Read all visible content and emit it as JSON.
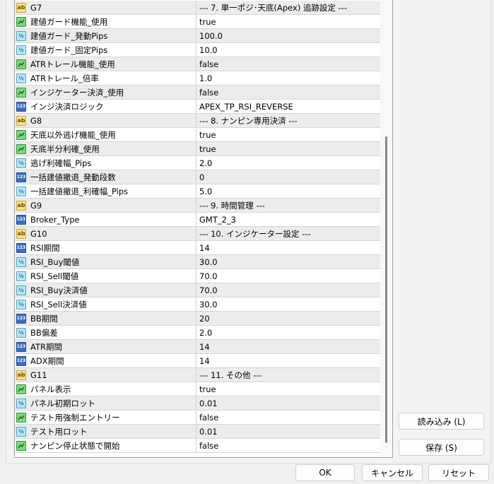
{
  "rows": [
    {
      "type": "string",
      "icon": "ab",
      "name": "G7",
      "value": "--- 7. 単一ポジ･天底(Apex) 追跡設定 ---"
    },
    {
      "type": "bool",
      "icon": "bool",
      "name": "建値ガード機能_使用",
      "value": "true"
    },
    {
      "type": "double",
      "icon": "½",
      "name": "建値ガード_発動Pips",
      "value": "100.0"
    },
    {
      "type": "double",
      "icon": "½",
      "name": "建値ガード_固定Pips",
      "value": "10.0"
    },
    {
      "type": "bool",
      "icon": "bool",
      "name": "ATRトレール機能_使用",
      "value": "false"
    },
    {
      "type": "double",
      "icon": "½",
      "name": "ATRトレール_倍率",
      "value": "1.0"
    },
    {
      "type": "bool",
      "icon": "bool",
      "name": "インジケーター決済_使用",
      "value": "false"
    },
    {
      "type": "int",
      "icon": "123",
      "name": "インジ決済ロジック",
      "value": "APEX_TP_RSI_REVERSE"
    },
    {
      "type": "string",
      "icon": "ab",
      "name": "G8",
      "value": "--- 8. ナンピン専用決済 ---"
    },
    {
      "type": "bool",
      "icon": "bool",
      "name": "天底以外逃げ機能_使用",
      "value": "true"
    },
    {
      "type": "bool",
      "icon": "bool",
      "name": "天底半分利確_使用",
      "value": "true"
    },
    {
      "type": "double",
      "icon": "½",
      "name": "逃げ利確幅_Pips",
      "value": "2.0"
    },
    {
      "type": "int",
      "icon": "123",
      "name": "一括建値撤退_発動段数",
      "value": "0"
    },
    {
      "type": "double",
      "icon": "½",
      "name": "一括建値撤退_利確幅_Pips",
      "value": "5.0"
    },
    {
      "type": "string",
      "icon": "ab",
      "name": "G9",
      "value": "--- 9. 時間管理 ---"
    },
    {
      "type": "int",
      "icon": "123",
      "name": "Broker_Type",
      "value": "GMT_2_3"
    },
    {
      "type": "string",
      "icon": "ab",
      "name": "G10",
      "value": "--- 10. インジケーター設定 ---"
    },
    {
      "type": "int",
      "icon": "123",
      "name": "RSI期間",
      "value": "14"
    },
    {
      "type": "double",
      "icon": "½",
      "name": "RSI_Buy閾値",
      "value": "30.0"
    },
    {
      "type": "double",
      "icon": "½",
      "name": "RSI_Sell閾値",
      "value": "70.0"
    },
    {
      "type": "double",
      "icon": "½",
      "name": "RSI_Buy決済値",
      "value": "70.0"
    },
    {
      "type": "double",
      "icon": "½",
      "name": "RSI_Sell決済値",
      "value": "30.0"
    },
    {
      "type": "int",
      "icon": "123",
      "name": "BB期間",
      "value": "20"
    },
    {
      "type": "double",
      "icon": "½",
      "name": "BB偏差",
      "value": "2.0"
    },
    {
      "type": "int",
      "icon": "123",
      "name": "ATR期間",
      "value": "14"
    },
    {
      "type": "int",
      "icon": "123",
      "name": "ADX期間",
      "value": "14"
    },
    {
      "type": "string",
      "icon": "ab",
      "name": "G11",
      "value": "--- 11. その他 ---"
    },
    {
      "type": "bool",
      "icon": "bool",
      "name": "パネル表示",
      "value": "true"
    },
    {
      "type": "double",
      "icon": "½",
      "name": "パネル初期ロット",
      "value": "0.01"
    },
    {
      "type": "bool",
      "icon": "bool",
      "name": "テスト用強制エントリー",
      "value": "false"
    },
    {
      "type": "double",
      "icon": "½",
      "name": "テスト用ロット",
      "value": "0.01"
    },
    {
      "type": "bool",
      "icon": "bool",
      "name": "ナンピン停止状態で開始",
      "value": "false"
    }
  ],
  "buttons": {
    "load": "読み込み (L)",
    "save": "保存 (S)",
    "ok": "OK",
    "cancel": "キャンセル",
    "reset": "リセット"
  }
}
